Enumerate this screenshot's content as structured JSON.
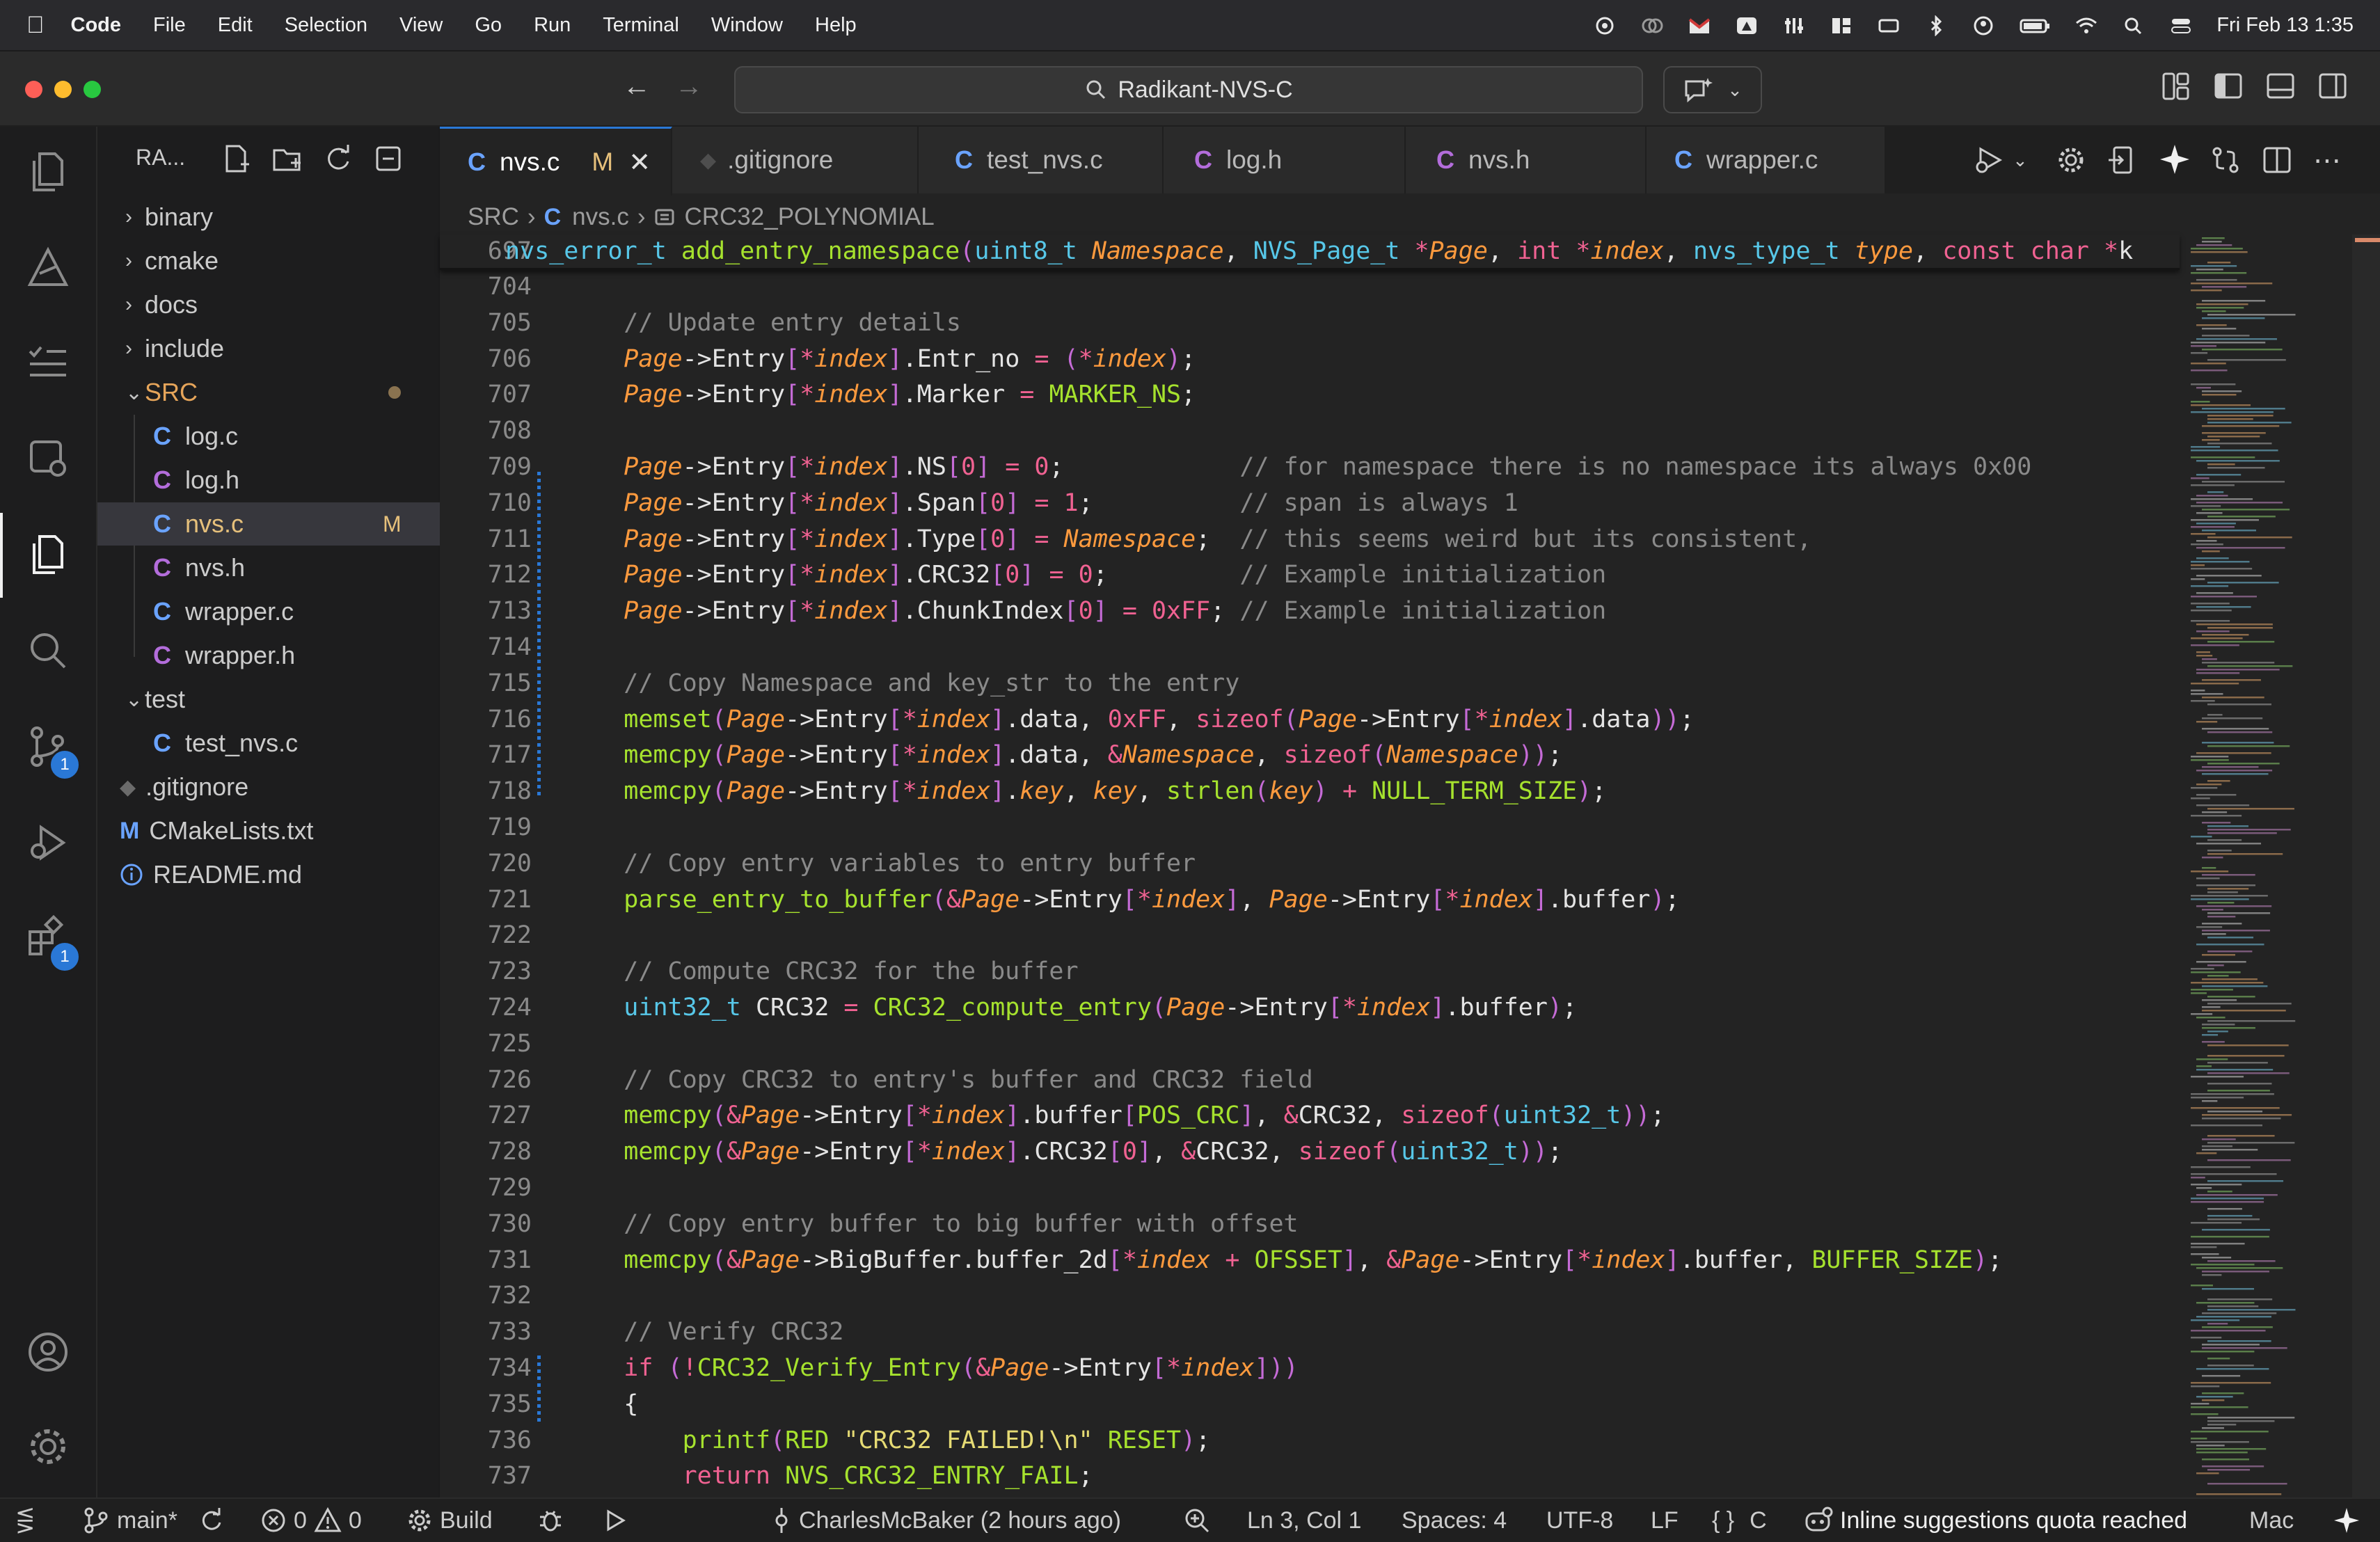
{
  "menubar": {
    "app": "Code",
    "items": [
      "File",
      "Edit",
      "Selection",
      "View",
      "Go",
      "Run",
      "Terminal",
      "Window",
      "Help"
    ],
    "clock": "Fri Feb 13  1:35"
  },
  "window": {
    "search_text": "Radikant-NVS-C"
  },
  "sidebar": {
    "title": "RA...",
    "tree": [
      {
        "label": "binary",
        "kind": "folder",
        "open": false,
        "depth": 0
      },
      {
        "label": "cmake",
        "kind": "folder",
        "open": false,
        "depth": 0
      },
      {
        "label": "docs",
        "kind": "folder",
        "open": false,
        "depth": 0
      },
      {
        "label": "include",
        "kind": "folder",
        "open": false,
        "depth": 0
      },
      {
        "label": "SRC",
        "kind": "folder",
        "open": true,
        "depth": 0
      },
      {
        "label": "log.c",
        "kind": "c",
        "depth": 1
      },
      {
        "label": "log.h",
        "kind": "c",
        "depth": 1
      },
      {
        "label": "nvs.c",
        "kind": "c",
        "depth": 1,
        "badge": "M",
        "selected": true
      },
      {
        "label": "nvs.h",
        "kind": "c",
        "depth": 1
      },
      {
        "label": "wrapper.c",
        "kind": "c",
        "depth": 1
      },
      {
        "label": "wrapper.h",
        "kind": "c",
        "depth": 1
      },
      {
        "label": "test",
        "kind": "folder",
        "open": true,
        "depth": 0
      },
      {
        "label": "test_nvs.c",
        "kind": "c",
        "depth": 1
      },
      {
        "label": ".gitignore",
        "kind": "git",
        "depth": 0
      },
      {
        "label": "CMakeLists.txt",
        "kind": "cmake",
        "depth": 0
      },
      {
        "label": "README.md",
        "kind": "info",
        "depth": 0
      }
    ]
  },
  "tabs": [
    {
      "label": "nvs.c",
      "icon": "C",
      "modified": "M",
      "active": true
    },
    {
      "label": ".gitignore",
      "icon": "◆"
    },
    {
      "label": "test_nvs.c",
      "icon": "C"
    },
    {
      "label": "log.h",
      "icon": "C"
    },
    {
      "label": "nvs.h",
      "icon": "C"
    },
    {
      "label": "wrapper.c",
      "icon": "C"
    }
  ],
  "breadcrumb": {
    "folder": "SRC",
    "file": "nvs.c",
    "symbol": "CRC32_POLYNOMIAL"
  },
  "sticky_line": {
    "number": "697",
    "text": "nvs_error_t add_entry_namespace(uint8_t Namespace, NVS_Page_t *Page, int *index, nvs_type_t type, const char *k"
  },
  "code_lines": [
    {
      "n": "704",
      "t": ""
    },
    {
      "n": "705",
      "t": "    // Update entry details"
    },
    {
      "n": "706",
      "t": "    Page->Entry[*index].Entr_no = (*index);"
    },
    {
      "n": "707",
      "t": "    Page->Entry[*index].Marker = MARKER_NS;"
    },
    {
      "n": "708",
      "t": ""
    },
    {
      "n": "709",
      "t": "    Page->Entry[*index].NS[0] = 0;            // for namespace there is no namespace its always 0x00"
    },
    {
      "n": "710",
      "t": "    Page->Entry[*index].Span[0] = 1;          // span is always 1"
    },
    {
      "n": "711",
      "t": "    Page->Entry[*index].Type[0] = Namespace;  // this seems weird but its consistent,"
    },
    {
      "n": "712",
      "t": "    Page->Entry[*index].CRC32[0] = 0;         // Example initialization"
    },
    {
      "n": "713",
      "t": "    Page->Entry[*index].ChunkIndex[0] = 0xFF; // Example initialization"
    },
    {
      "n": "714",
      "t": ""
    },
    {
      "n": "715",
      "t": "    // Copy Namespace and key_str to the entry"
    },
    {
      "n": "716",
      "t": "    memset(Page->Entry[*index].data, 0xFF, sizeof(Page->Entry[*index].data));"
    },
    {
      "n": "717",
      "t": "    memcpy(Page->Entry[*index].data, &Namespace, sizeof(Namespace));"
    },
    {
      "n": "718",
      "t": "    memcpy(Page->Entry[*index].key, key, strlen(key) + NULL_TERM_SIZE);"
    },
    {
      "n": "719",
      "t": ""
    },
    {
      "n": "720",
      "t": "    // Copy entry variables to entry buffer"
    },
    {
      "n": "721",
      "t": "    parse_entry_to_buffer(&Page->Entry[*index], Page->Entry[*index].buffer);"
    },
    {
      "n": "722",
      "t": ""
    },
    {
      "n": "723",
      "t": "    // Compute CRC32 for the buffer"
    },
    {
      "n": "724",
      "t": "    uint32_t CRC32 = CRC32_compute_entry(Page->Entry[*index].buffer);"
    },
    {
      "n": "725",
      "t": ""
    },
    {
      "n": "726",
      "t": "    // Copy CRC32 to entry's buffer and CRC32 field"
    },
    {
      "n": "727",
      "t": "    memcpy(&Page->Entry[*index].buffer[POS_CRC], &CRC32, sizeof(uint32_t));"
    },
    {
      "n": "728",
      "t": "    memcpy(&Page->Entry[*index].CRC32[0], &CRC32, sizeof(uint32_t));"
    },
    {
      "n": "729",
      "t": ""
    },
    {
      "n": "730",
      "t": "    // Copy entry buffer to big buffer with offset"
    },
    {
      "n": "731",
      "t": "    memcpy(&Page->BigBuffer.buffer_2d[*index + OFSSET], &Page->Entry[*index].buffer, BUFFER_SIZE);"
    },
    {
      "n": "732",
      "t": ""
    },
    {
      "n": "733",
      "t": "    // Verify CRC32"
    },
    {
      "n": "734",
      "t": "    if (!CRC32_Verify_Entry(&Page->Entry[*index]))"
    },
    {
      "n": "735",
      "t": "    {"
    },
    {
      "n": "736",
      "t": "        printf(RED \"CRC32 FAILED!\\n\" RESET);"
    },
    {
      "n": "737",
      "t": "        return NVS_CRC32_ENTRY_FAIL;"
    }
  ],
  "activity_badges": {
    "source_control": "1",
    "extensions": "1"
  },
  "statusbar": {
    "branch": "main*",
    "errors": "0",
    "warnings": "0",
    "build": "Build",
    "blame": "CharlesMcBaker (2 hours ago)",
    "position": "Ln 3, Col 1",
    "spaces": "Spaces: 4",
    "encoding": "UTF-8",
    "eol": "LF",
    "language_icon": "{ }",
    "language": "C",
    "copilot": "Inline suggestions quota reached",
    "platform": "Mac"
  },
  "colors": {
    "accent": "#2a78d6",
    "keyword": "#f06292",
    "type": "#57c7e8",
    "function": "#a6e22e",
    "variable": "#fd9a3e",
    "comment": "#8a8a8a"
  }
}
